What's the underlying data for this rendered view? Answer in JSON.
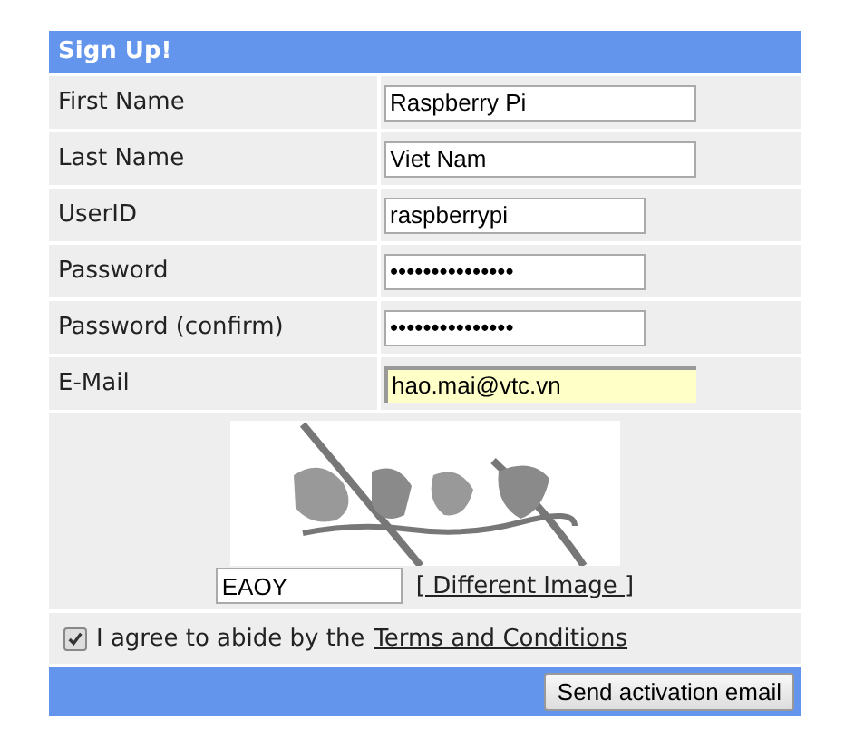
{
  "header": {
    "title": "Sign Up!"
  },
  "fields": [
    {
      "label": "First Name",
      "value": "Raspberry Pi",
      "kind": "text",
      "highlighted": false
    },
    {
      "label": "Last Name",
      "value": "Viet Nam",
      "kind": "text",
      "highlighted": false
    },
    {
      "label": "UserID",
      "value": "raspberrypi",
      "kind": "user",
      "highlighted": false
    },
    {
      "label": "Password",
      "value": "•••••••••••••••",
      "kind": "password",
      "highlighted": false
    },
    {
      "label": "Password (confirm)",
      "value": "•••••••••••••••",
      "kind": "password",
      "highlighted": false
    },
    {
      "label": "E-Mail",
      "value": "hao.mai@vtc.vn",
      "kind": "email",
      "highlighted": true
    }
  ],
  "captcha": {
    "answer": "EAOY",
    "refresh_link": "[ Different Image ]"
  },
  "agreement": {
    "checked": true,
    "text": "I agree to abide by the",
    "link": "Terms and Conditions"
  },
  "footer": {
    "button": "Send activation email"
  }
}
